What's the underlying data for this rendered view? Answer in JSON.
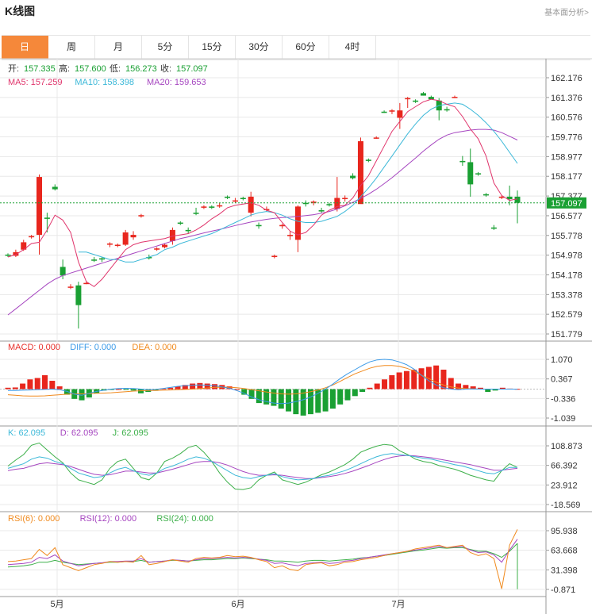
{
  "header": {
    "title": "K线图",
    "link": "基本面分析>"
  },
  "tabs": [
    "日",
    "周",
    "月",
    "5分",
    "15分",
    "30分",
    "60分",
    "4时"
  ],
  "active_tab": 0,
  "info": {
    "ohlc": [
      {
        "label": "开:",
        "value": "157.335"
      },
      {
        "label": "高:",
        "value": "157.600"
      },
      {
        "label": "低:",
        "value": "156.273"
      },
      {
        "label": "收:",
        "value": "157.097"
      }
    ],
    "ma": [
      {
        "text": "MA5: 157.259",
        "color": "#e0356c"
      },
      {
        "text": "MA10: 158.398",
        "color": "#3bb8d8"
      },
      {
        "text": "MA20: 159.653",
        "color": "#a646c0"
      }
    ],
    "macd": [
      {
        "text": "MACD: 0.000",
        "color": "#e8302b"
      },
      {
        "text": "DIFF: 0.000",
        "color": "#3a9ae8"
      },
      {
        "text": "DEA: 0.000",
        "color": "#f08a1e"
      }
    ],
    "kdj": [
      {
        "text": "K: 62.095",
        "color": "#3bb8d8"
      },
      {
        "text": "D: 62.095",
        "color": "#a646c0"
      },
      {
        "text": "J: 62.095",
        "color": "#3db04a"
      }
    ],
    "rsi": [
      {
        "text": "RSI(6): 0.000",
        "color": "#f08a1e"
      },
      {
        "text": "RSI(12): 0.000",
        "color": "#a646c0"
      },
      {
        "text": "RSI(24): 0.000",
        "color": "#3db04a"
      }
    ]
  },
  "colors": {
    "up": "#e8261d",
    "down": "#1aa033",
    "ma5": "#e0356c",
    "ma10": "#3bb8d8",
    "ma20": "#a646c0",
    "diff": "#3a9ae8",
    "dea": "#f08a1e",
    "grid": "#e8e8e8"
  },
  "chart_data": {
    "type": "candlestick",
    "price_axis": {
      "ticks": [
        "162.176",
        "161.376",
        "160.576",
        "159.776",
        "158.977",
        "158.177",
        "157.377",
        "156.577",
        "155.778",
        "154.978",
        "154.178",
        "153.378",
        "152.579",
        "151.779"
      ],
      "ylim": [
        151.779,
        162.176
      ]
    },
    "last_price": "157.097",
    "x_tick_labels": [
      "5月",
      "6月",
      "7月"
    ],
    "candles": [
      [
        155.0,
        155.05,
        154.9,
        154.95
      ],
      [
        154.95,
        155.2,
        154.9,
        155.1
      ],
      [
        155.2,
        155.6,
        155.15,
        155.5
      ],
      [
        155.75,
        155.8,
        155.65,
        155.75
      ],
      [
        155.8,
        158.25,
        155.0,
        158.15
      ],
      [
        156.5,
        156.7,
        155.9,
        156.45
      ],
      [
        157.75,
        157.85,
        157.6,
        157.65
      ],
      [
        154.5,
        154.8,
        154.0,
        154.15
      ],
      [
        153.7,
        153.8,
        153.6,
        153.7
      ],
      [
        153.75,
        153.9,
        152.0,
        152.95
      ],
      [
        153.85,
        153.9,
        153.8,
        153.85
      ],
      [
        154.8,
        154.9,
        154.7,
        154.75
      ],
      [
        154.85,
        154.9,
        154.7,
        154.8
      ],
      [
        155.4,
        155.5,
        155.3,
        155.45
      ],
      [
        155.35,
        155.45,
        155.3,
        155.4
      ],
      [
        155.4,
        156.0,
        155.35,
        155.9
      ],
      [
        155.7,
        155.95,
        155.6,
        155.8
      ],
      [
        156.55,
        156.65,
        156.5,
        156.6
      ],
      [
        154.9,
        155.0,
        154.8,
        154.85
      ],
      [
        155.2,
        155.3,
        155.15,
        155.25
      ],
      [
        155.3,
        155.45,
        155.25,
        155.4
      ],
      [
        155.55,
        156.1,
        155.4,
        156.0
      ],
      [
        156.3,
        156.35,
        156.2,
        156.25
      ],
      [
        156.0,
        156.1,
        155.85,
        155.95
      ],
      [
        156.7,
        156.9,
        156.6,
        156.65
      ],
      [
        156.95,
        157.0,
        156.85,
        156.95
      ],
      [
        156.95,
        157.0,
        156.85,
        156.9
      ],
      [
        157.0,
        157.1,
        156.9,
        157.0
      ],
      [
        157.35,
        157.4,
        157.25,
        157.3
      ],
      [
        157.15,
        157.3,
        157.1,
        157.2
      ],
      [
        157.3,
        157.35,
        157.2,
        157.25
      ],
      [
        156.7,
        157.55,
        156.55,
        157.35
      ],
      [
        156.2,
        156.3,
        156.05,
        156.15
      ],
      [
        156.85,
        156.95,
        156.75,
        156.85
      ],
      [
        154.9,
        155.0,
        154.85,
        154.95
      ],
      [
        156.15,
        156.25,
        156.05,
        156.2
      ],
      [
        155.75,
        155.95,
        155.6,
        155.8
      ],
      [
        155.6,
        157.0,
        155.1,
        156.95
      ],
      [
        157.1,
        157.2,
        156.95,
        157.05
      ],
      [
        157.1,
        157.2,
        157.0,
        157.15
      ],
      [
        156.8,
        156.9,
        156.7,
        156.75
      ],
      [
        157.05,
        157.1,
        156.95,
        157.0
      ],
      [
        156.85,
        158.15,
        156.75,
        157.3
      ],
      [
        157.25,
        157.4,
        157.15,
        157.3
      ],
      [
        158.2,
        158.3,
        158.05,
        158.1
      ],
      [
        157.05,
        159.75,
        158.0,
        159.6
      ],
      [
        158.85,
        158.9,
        158.75,
        158.8
      ],
      [
        159.75,
        159.8,
        159.7,
        159.75
      ],
      [
        160.8,
        160.85,
        160.75,
        160.75
      ],
      [
        160.8,
        160.9,
        160.7,
        160.85
      ],
      [
        160.55,
        161.15,
        160.1,
        160.85
      ],
      [
        161.35,
        161.4,
        160.95,
        161.35
      ],
      [
        161.25,
        161.3,
        161.15,
        161.2
      ],
      [
        161.55,
        161.6,
        161.45,
        161.45
      ],
      [
        161.4,
        161.45,
        161.3,
        161.3
      ],
      [
        161.25,
        161.35,
        160.45,
        160.85
      ],
      [
        160.9,
        161.0,
        160.8,
        160.85
      ],
      [
        161.4,
        161.45,
        161.35,
        161.4
      ],
      [
        158.8,
        159.0,
        158.6,
        158.75
      ],
      [
        158.75,
        159.3,
        157.35,
        157.85
      ],
      [
        158.3,
        158.35,
        158.2,
        158.25
      ],
      [
        157.45,
        157.5,
        157.35,
        157.4
      ],
      [
        156.1,
        156.2,
        156.0,
        156.05
      ],
      [
        157.35,
        157.4,
        157.25,
        157.35
      ],
      [
        157.35,
        157.8,
        157.0,
        157.25
      ],
      [
        157.35,
        157.6,
        156.27,
        157.1
      ]
    ],
    "ma5": [
      154.9,
      155.0,
      155.2,
      155.45,
      155.5,
      156.0,
      156.6,
      156.4,
      155.9,
      154.7,
      153.9,
      153.7,
      154.0,
      154.4,
      154.8,
      155.2,
      155.4,
      155.5,
      155.55,
      155.6,
      155.65,
      155.75,
      155.8,
      155.85,
      156.0,
      156.2,
      156.45,
      156.65,
      156.9,
      157.0,
      157.05,
      157.1,
      157.0,
      156.8,
      156.7,
      156.3,
      155.95,
      155.8,
      155.9,
      156.2,
      156.6,
      156.8,
      156.95,
      157.0,
      157.3,
      157.8,
      158.2,
      158.8,
      159.4,
      160.0,
      160.4,
      160.8,
      161.0,
      161.2,
      161.3,
      161.25,
      161.1,
      161.0,
      160.6,
      160.1,
      159.7,
      159.0,
      157.9,
      157.4,
      157.2,
      157.26
    ],
    "ma10": [
      null,
      null,
      null,
      null,
      null,
      null,
      null,
      null,
      null,
      155.1,
      155.1,
      155.0,
      154.9,
      154.8,
      154.8,
      154.7,
      154.7,
      154.8,
      154.9,
      155.0,
      155.2,
      155.3,
      155.45,
      155.55,
      155.65,
      155.75,
      155.85,
      156.0,
      156.15,
      156.3,
      156.45,
      156.6,
      156.7,
      156.75,
      156.7,
      156.6,
      156.45,
      156.35,
      156.3,
      156.3,
      156.35,
      156.45,
      156.55,
      156.75,
      157.0,
      157.35,
      157.7,
      158.1,
      158.55,
      159.0,
      159.45,
      159.9,
      160.3,
      160.65,
      160.9,
      161.05,
      161.1,
      161.15,
      161.1,
      160.9,
      160.65,
      160.35,
      160.0,
      159.6,
      159.15,
      158.7
    ],
    "ma20": [
      152.55,
      152.8,
      153.05,
      153.3,
      153.55,
      153.8,
      154.0,
      154.15,
      154.25,
      154.35,
      154.45,
      154.55,
      154.65,
      154.75,
      154.85,
      154.95,
      155.05,
      155.15,
      155.25,
      155.35,
      155.45,
      155.55,
      155.65,
      155.72,
      155.8,
      155.88,
      155.95,
      156.02,
      156.1,
      156.18,
      156.25,
      156.32,
      156.38,
      156.43,
      156.47,
      156.5,
      156.52,
      156.55,
      156.58,
      156.62,
      156.68,
      156.75,
      156.85,
      156.98,
      157.12,
      157.28,
      157.45,
      157.65,
      157.88,
      158.12,
      158.38,
      158.65,
      158.92,
      159.2,
      159.45,
      159.68,
      159.85,
      159.95,
      160.0,
      160.05,
      160.08,
      160.08,
      160.05,
      159.95,
      159.8,
      159.65
    ],
    "macd": {
      "axis_ticks": [
        "1.070",
        "0.367",
        "-0.336",
        "-1.039"
      ],
      "ylim": [
        -1.039,
        1.07
      ],
      "hist": [
        0.05,
        0.06,
        0.2,
        0.35,
        0.4,
        0.5,
        0.3,
        0.1,
        -0.2,
        -0.35,
        -0.4,
        -0.3,
        -0.15,
        -0.05,
        -0.02,
        0.0,
        -0.02,
        -0.05,
        -0.15,
        -0.1,
        -0.05,
        0.02,
        0.05,
        0.1,
        0.15,
        0.2,
        0.22,
        0.2,
        0.18,
        0.15,
        0.1,
        0.0,
        -0.2,
        -0.35,
        -0.5,
        -0.55,
        -0.6,
        -0.7,
        -0.8,
        -0.9,
        -0.95,
        -0.9,
        -0.85,
        -0.8,
        -0.7,
        -0.55,
        -0.4,
        -0.25,
        -0.1,
        0.05,
        0.2,
        0.35,
        0.5,
        0.6,
        0.65,
        0.7,
        0.75,
        0.8,
        0.85,
        0.7,
        0.4,
        0.2,
        0.15,
        0.1,
        0.05,
        -0.1,
        -0.05,
        0.05,
        0.02,
        0.01
      ],
      "diff": [
        -0.05,
        -0.05,
        -0.04,
        -0.03,
        -0.02,
        -0.01,
        0.0,
        -0.02,
        -0.08,
        -0.18,
        -0.22,
        -0.15,
        -0.08,
        -0.04,
        0.0,
        0.02,
        0.03,
        0.02,
        0.0,
        -0.02,
        -0.01,
        0.02,
        0.06,
        0.1,
        0.12,
        0.14,
        0.15,
        0.14,
        0.12,
        0.08,
        0.03,
        -0.05,
        -0.15,
        -0.28,
        -0.38,
        -0.45,
        -0.5,
        -0.52,
        -0.5,
        -0.45,
        -0.38,
        -0.28,
        -0.15,
        0.0,
        0.18,
        0.38,
        0.55,
        0.7,
        0.85,
        0.98,
        1.05,
        1.07,
        1.05,
        0.98,
        0.88,
        0.72,
        0.5,
        0.3,
        0.15,
        0.05,
        0.0,
        -0.02,
        0.0,
        0.01,
        0.0,
        0.0,
        0.0,
        0.0,
        0.0,
        0.0
      ],
      "dea": [
        -0.2,
        -0.22,
        -0.24,
        -0.25,
        -0.25,
        -0.24,
        -0.22,
        -0.2,
        -0.18,
        -0.17,
        -0.17,
        -0.16,
        -0.15,
        -0.14,
        -0.13,
        -0.11,
        -0.09,
        -0.07,
        -0.06,
        -0.05,
        -0.05,
        -0.04,
        -0.03,
        -0.02,
        -0.01,
        0.0,
        0.02,
        0.04,
        0.06,
        0.07,
        0.07,
        0.05,
        0.02,
        -0.02,
        -0.06,
        -0.1,
        -0.14,
        -0.17,
        -0.18,
        -0.17,
        -0.14,
        -0.09,
        -0.03,
        0.05,
        0.15,
        0.28,
        0.42,
        0.55,
        0.65,
        0.75,
        0.82,
        0.85,
        0.85,
        0.82,
        0.75,
        0.65,
        0.5,
        0.38,
        0.25,
        0.15,
        0.08,
        0.04,
        0.02,
        0.01,
        0.0,
        0.0,
        0.0,
        0.0,
        0.0,
        0.0
      ]
    },
    "kdj": {
      "axis_ticks": [
        "108.873",
        "66.392",
        "23.912",
        "-18.569"
      ],
      "ylim": [
        -18.569,
        108.873
      ],
      "k": [
        60,
        65,
        70,
        80,
        85,
        82,
        75,
        70,
        60,
        50,
        45,
        40,
        42,
        50,
        58,
        62,
        55,
        48,
        45,
        50,
        60,
        65,
        72,
        80,
        85,
        82,
        75,
        65,
        55,
        45,
        40,
        38,
        42,
        45,
        48,
        42,
        38,
        35,
        36,
        38,
        42,
        45,
        50,
        55,
        62,
        70,
        78,
        85,
        90,
        92,
        90,
        88,
        85,
        82,
        80,
        76,
        72,
        68,
        65,
        60,
        55,
        50,
        48,
        55,
        62,
        62
      ],
      "d": [
        55,
        58,
        60,
        65,
        70,
        72,
        70,
        68,
        64,
        58,
        52,
        47,
        45,
        46,
        50,
        54,
        54,
        52,
        50,
        50,
        54,
        58,
        63,
        68,
        73,
        75,
        75,
        72,
        67,
        60,
        53,
        48,
        45,
        45,
        46,
        45,
        42,
        40,
        38,
        38,
        40,
        42,
        45,
        49,
        54,
        60,
        66,
        73,
        79,
        84,
        87,
        88,
        87,
        85,
        83,
        80,
        77,
        74,
        71,
        68,
        64,
        60,
        56,
        56,
        58,
        60
      ],
      "j": [
        65,
        78,
        90,
        110,
        115,
        100,
        85,
        72,
        50,
        35,
        30,
        25,
        35,
        60,
        75,
        80,
        60,
        40,
        35,
        50,
        75,
        82,
        92,
        105,
        110,
        95,
        75,
        50,
        30,
        15,
        14,
        18,
        35,
        45,
        52,
        35,
        30,
        25,
        30,
        38,
        46,
        52,
        60,
        68,
        80,
        95,
        102,
        108,
        112,
        110,
        98,
        90,
        80,
        75,
        72,
        66,
        62,
        58,
        52,
        45,
        40,
        35,
        32,
        55,
        70,
        62
      ]
    },
    "rsi": {
      "axis_ticks": [
        "95.938",
        "63.668",
        "31.398",
        "-0.871"
      ],
      "ylim": [
        -0.871,
        95.938
      ],
      "rsi6": [
        45,
        46,
        48,
        50,
        65,
        55,
        68,
        40,
        35,
        30,
        35,
        40,
        42,
        45,
        44,
        45,
        44,
        55,
        40,
        42,
        45,
        48,
        46,
        44,
        50,
        52,
        51,
        52,
        55,
        53,
        54,
        52,
        48,
        45,
        35,
        38,
        32,
        30,
        40,
        42,
        43,
        38,
        40,
        44,
        45,
        48,
        50,
        52,
        55,
        58,
        60,
        62,
        66,
        68,
        70,
        72,
        68,
        70,
        72,
        60,
        55,
        58,
        50,
        0,
        72,
        98
      ],
      "rsi12": [
        40,
        41,
        42,
        44,
        52,
        50,
        56,
        46,
        42,
        38,
        40,
        42,
        43,
        45,
        45,
        46,
        46,
        50,
        44,
        45,
        46,
        48,
        47,
        46,
        48,
        50,
        50,
        51,
        52,
        51,
        52,
        51,
        49,
        47,
        42,
        43,
        40,
        38,
        42,
        43,
        44,
        42,
        43,
        46,
        47,
        50,
        52,
        54,
        56,
        58,
        60,
        62,
        64,
        66,
        68,
        70,
        68,
        69,
        70,
        64,
        60,
        61,
        56,
        44,
        64,
        82
      ],
      "rsi24": [
        36,
        37,
        38,
        40,
        44,
        44,
        47,
        44,
        42,
        40,
        41,
        42,
        43,
        44,
        44,
        45,
        45,
        47,
        44,
        45,
        46,
        47,
        47,
        46,
        47,
        48,
        48,
        49,
        50,
        50,
        51,
        50,
        49,
        48,
        46,
        46,
        45,
        44,
        46,
        47,
        47,
        46,
        47,
        48,
        49,
        51,
        52,
        54,
        55,
        57,
        59,
        61,
        63,
        64,
        66,
        68,
        67,
        68,
        68,
        65,
        62,
        62,
        58,
        52,
        62,
        75
      ]
    },
    "rsi_tail": [
      -0.5
    ]
  }
}
